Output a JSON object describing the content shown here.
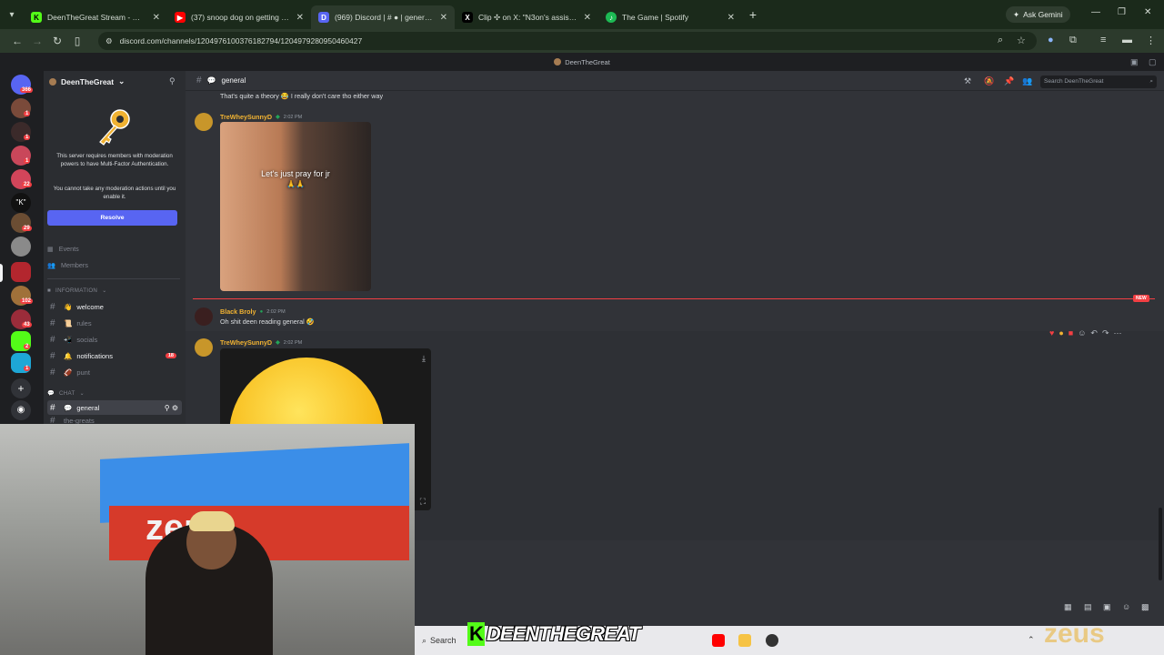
{
  "browser": {
    "tabs": [
      {
        "title": "DeenTheGreat Stream - Watch",
        "favicon": "kick-icon",
        "color": "#53fc18",
        "glyph": "K"
      },
      {
        "title": "(37) snoop dog on getting rid o",
        "favicon": "youtube-icon",
        "color": "#ff0000",
        "glyph": "▶"
      },
      {
        "title": "(969) Discord | # ● | general |",
        "favicon": "discord-icon",
        "color": "#5865f2",
        "glyph": "D"
      },
      {
        "title": "Clip ✣ on X: \"N3on's assistant t",
        "favicon": "x-icon",
        "color": "#000000",
        "glyph": "X"
      },
      {
        "title": "The Game | Spotify",
        "favicon": "spotify-icon",
        "color": "#1db954",
        "glyph": "♪"
      }
    ],
    "active_tab": 2,
    "ask_gemini": "Ask Gemini",
    "url": "discord.com/channels/1204976100376182794/1204979280950460427"
  },
  "discord": {
    "window_title": "DeenTheGreat",
    "server_name": "DeenTheGreat",
    "mfa_notice": "This server requires members with moderation powers to have Multi-Factor Authentication.",
    "mfa_sub": "You cannot take any moderation actions until you enable it.",
    "resolve_label": "Resolve",
    "events_label": "Events",
    "members_label": "Members",
    "category_info": "INFORMATION",
    "category_chat": "CHAT",
    "channels_info": [
      {
        "name": "welcome",
        "emoji": "👋",
        "bold": true
      },
      {
        "name": "rules",
        "emoji": "📜",
        "bold": false
      },
      {
        "name": "socials",
        "emoji": "📲",
        "bold": false
      },
      {
        "name": "notifications",
        "emoji": "🔔",
        "bold": true,
        "badge": "18"
      },
      {
        "name": "punt",
        "emoji": "🏈",
        "bold": false
      }
    ],
    "channel_chat": {
      "name": "general",
      "emoji": "💬"
    },
    "channel_next": "the-greats",
    "header_channel": "general",
    "search_placeholder": "Search DeenTheGreat",
    "messages": {
      "prev_text": "That's quite a theory 😂 I really don't care tho either way",
      "m1_user": "TreWheySunnyD",
      "m1_time": "2:02 PM",
      "m1_caption": "Let's just pray for jr",
      "m1_caption2": "🙏🙏",
      "new_tag": "NEW",
      "m2_user": "Black Broly",
      "m2_time": "2:02 PM",
      "m2_text": "Oh shit deen reading general 🤣",
      "m3_user": "TreWheySunnyD",
      "m3_time": "2:02 PM"
    },
    "server_badges": [
      "366",
      "1",
      "1",
      "1",
      "22",
      "29",
      "102",
      "18",
      "43",
      "2",
      "1"
    ]
  },
  "stream": {
    "overlay_name": "DEENTHEGREAT",
    "overlay_k": "K",
    "sponsor": "zeus",
    "taskbar_search": "Search"
  }
}
